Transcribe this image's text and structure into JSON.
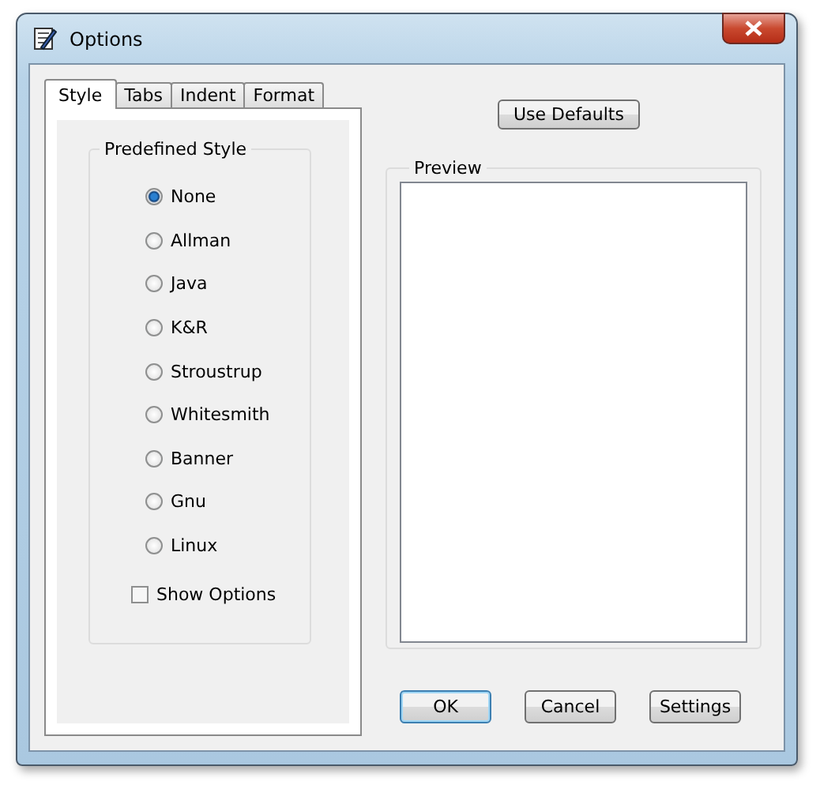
{
  "window": {
    "title": "Options"
  },
  "tabs": [
    {
      "label": "Style",
      "selected": true
    },
    {
      "label": "Tabs",
      "selected": false
    },
    {
      "label": "Indent",
      "selected": false
    },
    {
      "label": "Format",
      "selected": false
    }
  ],
  "predefined_style": {
    "label": "Predefined Style",
    "options": [
      {
        "label": "None",
        "selected": true
      },
      {
        "label": "Allman",
        "selected": false
      },
      {
        "label": "Java",
        "selected": false
      },
      {
        "label": "K&R",
        "selected": false
      },
      {
        "label": "Stroustrup",
        "selected": false
      },
      {
        "label": "Whitesmith",
        "selected": false
      },
      {
        "label": "Banner",
        "selected": false
      },
      {
        "label": "Gnu",
        "selected": false
      },
      {
        "label": "Linux",
        "selected": false
      }
    ]
  },
  "show_options": {
    "label": "Show Options",
    "checked": false
  },
  "use_defaults_button": "Use Defaults",
  "preview": {
    "label": "Preview"
  },
  "buttons": [
    {
      "label": "OK",
      "default": true
    },
    {
      "label": "Cancel",
      "default": false
    },
    {
      "label": "Settings",
      "default": false
    }
  ]
}
